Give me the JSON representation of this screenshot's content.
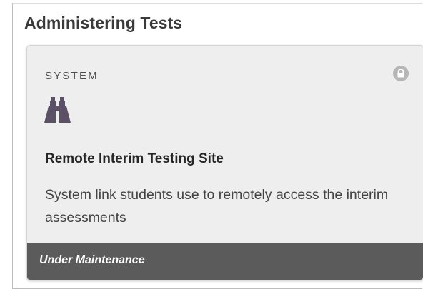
{
  "section": {
    "title": "Administering Tests"
  },
  "card": {
    "category": "SYSTEM",
    "icon": "binoculars-icon",
    "status_icon": "lock-icon",
    "title": "Remote Interim Testing Site",
    "description": "System link students use to remotely access the interim assessments",
    "status": "Under Maintenance"
  },
  "colors": {
    "card_background": "#eeeeee",
    "status_bar": "#5b5b5b",
    "icon": "#5b5066",
    "lock_icon": "#b6b6b6"
  }
}
